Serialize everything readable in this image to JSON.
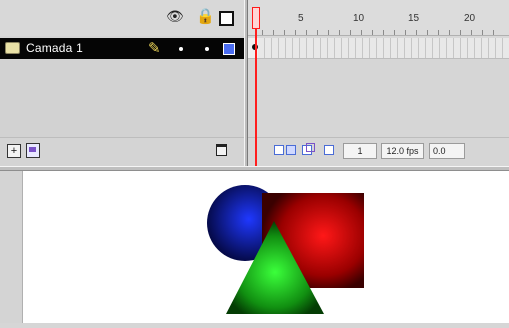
{
  "timeline": {
    "header_icons": [
      "eye-icon",
      "lock-icon",
      "outline-icon"
    ],
    "layer": {
      "name": "Camada 1",
      "icon": "layer-icon",
      "edit_icon": "pencil-icon",
      "outline_color": "#4a6cf0"
    },
    "frame_numbers": [
      "5",
      "10",
      "15",
      "20"
    ],
    "footer": {
      "current_frame": "1",
      "frame_rate": "12.0 fps",
      "elapsed_time": "0.0"
    }
  },
  "stage": {
    "shapes": [
      {
        "name": "blue-circle",
        "color": "#0f1fc8"
      },
      {
        "name": "red-square",
        "color": "#ff1010"
      },
      {
        "name": "green-triangle",
        "color": "#22e022"
      }
    ]
  }
}
